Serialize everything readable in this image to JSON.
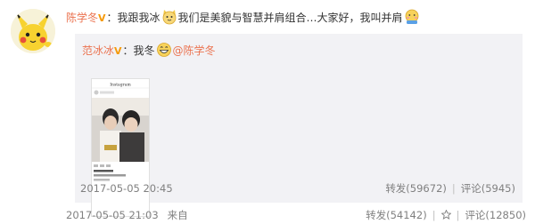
{
  "post": {
    "author": "陈学冬",
    "verified_mark": "V",
    "text_parts": [
      "：我跟我冰",
      "我们是美貌与智慧并肩组合…大家好，我叫并肩"
    ],
    "emoji_names": [
      "cat-face-icon",
      "bashful-face-icon"
    ],
    "time": "2017-05-05 21:03",
    "source_label": "来自",
    "forward_label": "转发(54142)",
    "comment_label": "评论(12850)"
  },
  "repost": {
    "author": "范冰冰",
    "verified_mark": "V",
    "text": "：我冬",
    "emoji_name": "grin-face-icon",
    "mention": "@陈学冬",
    "time": "2017-05-05 20:45",
    "forward_label": "转发(59672)",
    "comment_label": "评论(5945)",
    "photo": {
      "header": "Instagram"
    }
  },
  "colors": {
    "username": "#eb7350",
    "meta": "#808080",
    "repost_bg": "#f2f2f5"
  }
}
